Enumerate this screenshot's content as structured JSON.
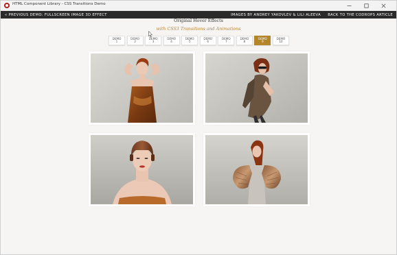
{
  "window": {
    "title": "HTML Component Library - CSS Transitions Demo",
    "controls": [
      "minimize-icon",
      "maximize-icon",
      "close-icon"
    ]
  },
  "topbar": {
    "prev_link": "« Previous Demo: Fullscreen Image 3D Effect",
    "credits": "Images by Andrey Yakovlev & Lili Aleeva",
    "back_link": "Back to the Codrops Article"
  },
  "header": {
    "title": "Original Hover Effects",
    "subtitle": "with CSS3 Transitions and Animations"
  },
  "demo_nav": [
    {
      "word": "DEMO",
      "num": "1",
      "active": false
    },
    {
      "word": "DEMO",
      "num": "2",
      "active": false
    },
    {
      "word": "DEMO",
      "num": "3",
      "active": false
    },
    {
      "word": "DEMO",
      "num": "4",
      "active": false
    },
    {
      "word": "DEMO",
      "num": "5",
      "active": false
    },
    {
      "word": "DEMO",
      "num": "6",
      "active": false
    },
    {
      "word": "DEMO",
      "num": "7",
      "active": false
    },
    {
      "word": "DEMO",
      "num": "8",
      "active": false
    },
    {
      "word": "DEMO",
      "num": "9",
      "active": true
    },
    {
      "word": "DEMO",
      "num": "10",
      "active": false
    }
  ],
  "gallery": [
    {
      "icon": "photo-model-hands-on-head"
    },
    {
      "icon": "photo-model-sunglasses"
    },
    {
      "icon": "photo-model-leather-cap"
    },
    {
      "icon": "photo-model-fur-stole"
    }
  ],
  "colors": {
    "accent": "#b4862b",
    "topbar": "#2a2a2a",
    "subtitle": "#b8843a",
    "page_background": "#f6f5f3"
  }
}
